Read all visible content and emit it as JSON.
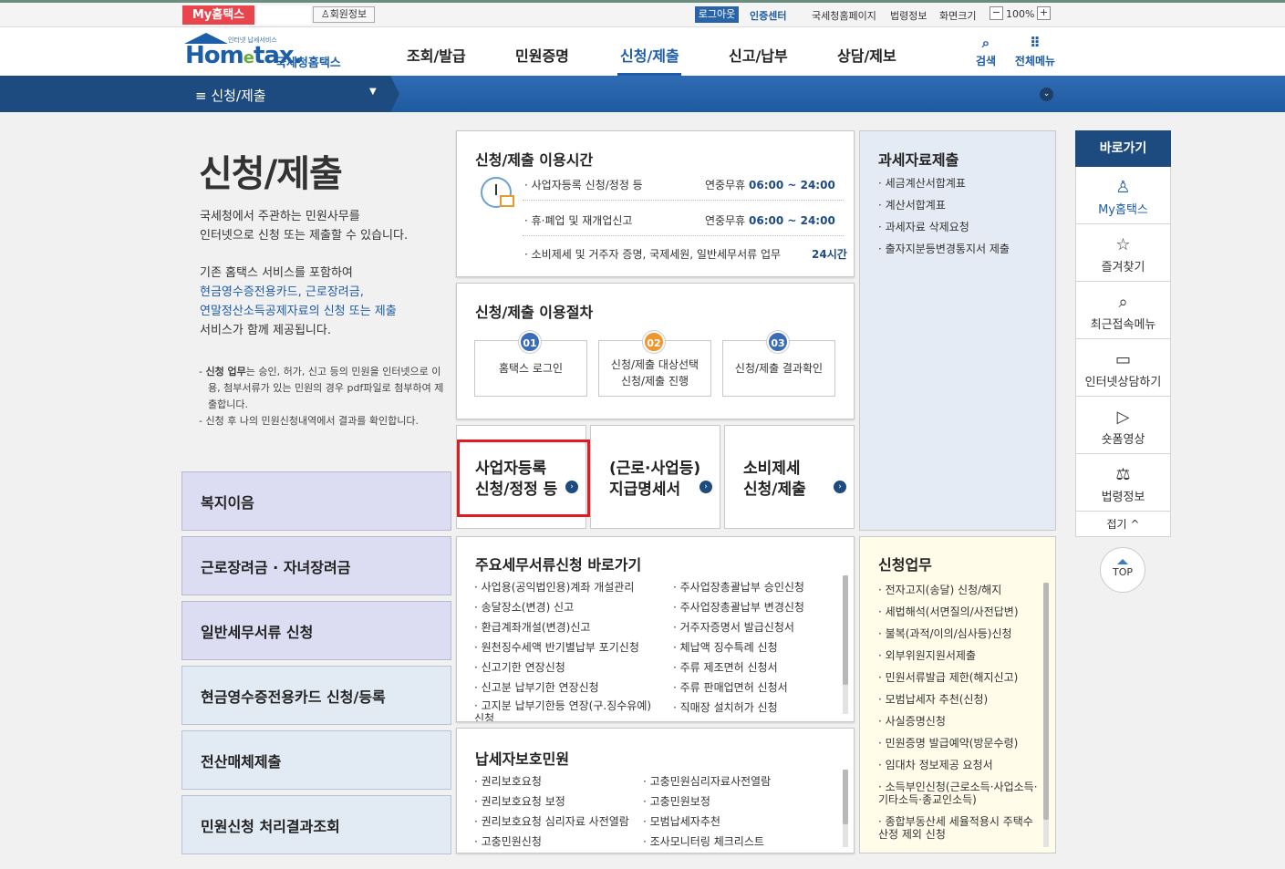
{
  "topbar": {
    "my_hometax": "My홈택스",
    "member_info": "회원정보",
    "logout": "로그아웃",
    "cert_center": "인증센터",
    "links": [
      "국세청홈페이지",
      "법령정보",
      "화면크기"
    ],
    "zoom_minus": "−",
    "zoom_value": "100%",
    "zoom_plus": "+"
  },
  "header": {
    "logo_small": "인터넷 납세서비스",
    "logo_main_a": "Hom",
    "logo_main_e": "e",
    "logo_main_b": "tax.",
    "logo_sub": "국세청홈택스",
    "nav": [
      "조회/발급",
      "민원증명",
      "신청/제출",
      "신고/납부",
      "상담/제보"
    ],
    "search_label": "검색",
    "allmenu_label": "전체메뉴"
  },
  "section_bar": {
    "title": "신청/제출"
  },
  "intro": {
    "title": "신청/제출",
    "para1": [
      "국세청에서 주관하는 민원사무를",
      "인터넷으로 신청 또는 제출할 수 있습니다."
    ],
    "para2_line1": "기존 홈택스 서비스를 포함하여",
    "para2_blue": [
      "현금영수증전용카드, 근로장려금,",
      "연말정산소득공제자료의 신청 또는 제출"
    ],
    "para2_last": "서비스가 함께 제공됩니다.",
    "note1_bold": "신청 업무",
    "note1_rest": "는 승인, 허가, 신고 등의 민원을 인터넷으로 이용, 첨부서류가 있는 민원의 경우 pdf파일로 첨부하여 제출합니다.",
    "note2": "신청 후 나의 민원신청내역에서 결과를 확인합니다."
  },
  "left_menu": [
    "복지이음",
    "근로장려금 · 자녀장려금",
    "일반세무서류 신청",
    "현금영수증전용카드 신청/등록",
    "전산매체제출",
    "민원신청 처리결과조회"
  ],
  "usage_time": {
    "title": "신청/제출 이용시간",
    "rows": [
      {
        "label": "사업자등록 신청/정정 등",
        "prefix": "연중무휴",
        "time": "06:00 ~ 24:00"
      },
      {
        "label": "휴·폐업 및 재개업신고",
        "prefix": "연중무휴",
        "time": "06:00 ~ 24:00"
      },
      {
        "label": "소비제세 및 거주자 증명, 국제세원, 일반세무서류 업무",
        "prefix": "",
        "time": "24시간"
      }
    ]
  },
  "procedure": {
    "title": "신청/제출 이용절차",
    "steps": [
      {
        "num": "01",
        "line1": "홈택스 로그인",
        "line2": "",
        "color": "#3a6db5"
      },
      {
        "num": "02",
        "line1": "신청/제출 대상선택",
        "line2": "신청/제출 진행",
        "color": "#f0962e"
      },
      {
        "num": "03",
        "line1": "신청/제출 결과확인",
        "line2": "",
        "color": "#3a6db5"
      }
    ]
  },
  "cards": [
    {
      "line1": "사업자등록",
      "line2": "신청/정정 등"
    },
    {
      "line1": "(근로·사업등)",
      "line2": "지급명세서"
    },
    {
      "line1": "소비제세",
      "line2": "신청/제출"
    }
  ],
  "tax_data": {
    "title": "과세자료제출",
    "items": [
      "세금계산서합계표",
      "계산서합계표",
      "과세자료 삭제요청",
      "출자지분등변경통지서 제출"
    ]
  },
  "main_docs": {
    "title": "주요세무서류신청 바로가기",
    "col1": [
      "사업용(공익법인용)계좌 개설관리",
      "송달장소(변경) 신고",
      "환급계좌개설(변경)신고",
      "원천징수세액 반기별납부 포기신청",
      "신고기한 연장신청",
      "신고분 납부기한 연장신청",
      "고지분 납부기한등 연장(구.징수유예) 신청"
    ],
    "col2": [
      "주사업장총괄납부 승인신청",
      "주사업장총괄납부 변경신청",
      "거주자증명서 발급신청서",
      "체납액 징수특례 신청",
      "주류 제조면허 신청서",
      "주류 판매업면허 신청서",
      "직매장 설치허가 신청"
    ]
  },
  "taxpayer": {
    "title": "납세자보호민원",
    "col1": [
      "권리보호요청",
      "권리보호요청 보정",
      "권리보호요청 심리자료 사전열람",
      "고충민원신청"
    ],
    "col2": [
      "고충민원심리자료사전열람",
      "고충민원보정",
      "모범납세자추천",
      "조사모니터링 체크리스트"
    ]
  },
  "apply_work": {
    "title": "신청업무",
    "items": [
      "전자고지(송달) 신청/해지",
      "세법해석(서면질의/사전답변)",
      "불복(과적/이의/심사등)신청",
      "외부위원지원서제출",
      "민원서류발급 제한(해지신고)",
      "모범납세자 추천(신청)",
      "사실증명신청",
      "민원증명 발급예약(방문수령)",
      "임대차 정보제공 요청서",
      "소득부인신청(근로소득·사업소득·기타소득·종교인소득)",
      "종합부동산세 세율적용시 주택수 산정 제외 신청"
    ]
  },
  "quick_menu": {
    "title": "바로가기",
    "items": [
      {
        "label": "My홈택스",
        "icon": "person-icon",
        "glyph": "♙"
      },
      {
        "label": "즐겨찾기",
        "icon": "star-icon",
        "glyph": "☆"
      },
      {
        "label": "최근접속메뉴",
        "icon": "recent-icon",
        "glyph": "⌕"
      },
      {
        "label": "인터넷상담하기",
        "icon": "monitor-icon",
        "glyph": "▭"
      },
      {
        "label": "숏폼영상",
        "icon": "play-icon",
        "glyph": "▷"
      },
      {
        "label": "법령정보",
        "icon": "gavel-icon",
        "glyph": "⚖"
      }
    ],
    "fold": "접기 ^",
    "top": "TOP"
  }
}
